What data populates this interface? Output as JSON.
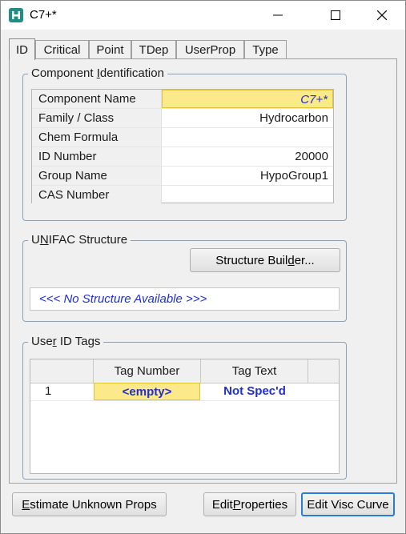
{
  "window": {
    "title": "C7+*"
  },
  "tabs": [
    {
      "label": "ID",
      "active": true
    },
    {
      "label": "Critical"
    },
    {
      "label": "Point"
    },
    {
      "label": "TDep"
    },
    {
      "label": "UserProp"
    },
    {
      "label": "Type"
    }
  ],
  "component_identification": {
    "label_pre": "Component ",
    "label_ul": "I",
    "label_post": "dentification",
    "rows": [
      {
        "name": "Component Name",
        "value": "C7+*"
      },
      {
        "name": "Family / Class",
        "value": "Hydrocarbon"
      },
      {
        "name": "Chem Formula",
        "value": ""
      },
      {
        "name": "ID Number",
        "value": "20000"
      },
      {
        "name": "Group Name",
        "value": "HypoGroup1"
      },
      {
        "name": "CAS Number",
        "value": ""
      }
    ]
  },
  "unifac": {
    "label_pre": "U",
    "label_ul": "N",
    "label_post": "IFAC Structure",
    "builder_pre": "Structure Buil",
    "builder_ul": "d",
    "builder_post": "er...",
    "no_structure_text": "<<< No Structure Available >>>"
  },
  "user_tags": {
    "label_pre": "Use",
    "label_ul": "r",
    "label_post": " ID Tags",
    "headers": [
      "",
      "Tag Number",
      "Tag Text"
    ],
    "rows": [
      {
        "index": "1",
        "tag_number": "<empty>",
        "tag_text": "Not Spec'd"
      }
    ]
  },
  "buttons": {
    "estimate_ul": "E",
    "estimate_post": "stimate Unknown Props",
    "edit_props_pre": "Edit ",
    "edit_props_ul": "P",
    "edit_props_post": "roperties",
    "edit_visc": "Edit Visc Curve"
  },
  "colors": {
    "selection_bg": "#fbe98a",
    "value_text": "#1f2fd0",
    "default_button_border": "#2a7be0"
  }
}
